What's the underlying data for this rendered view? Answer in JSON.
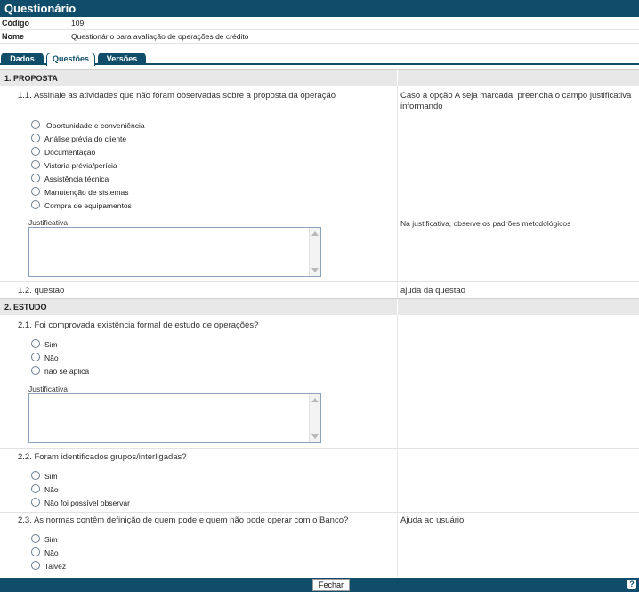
{
  "window": {
    "title": "Questionário"
  },
  "info": {
    "codigo_label": "Código",
    "codigo_value": "109",
    "nome_label": "Nome",
    "nome_value": "Questionário para avaliação de operações de crédito"
  },
  "tabs": [
    {
      "label": "Dados"
    },
    {
      "label": "Questões"
    },
    {
      "label": "Versões"
    }
  ],
  "active_tab": "Questões",
  "sections": [
    {
      "title": "1. PROPOSTA",
      "questions": [
        {
          "text": "1.1. Assinale as atividades que não foram observadas sobre a proposta da operação",
          "help": "Caso a opção A seja marcada, preencha o campo justificativa informando",
          "options": [
            "Oportunidade e conveniência",
            "Análise prévia do cliente",
            "Documentação",
            "Vistoria prévia/perícia",
            "Assistência técnica",
            "Manutenção de sistemas",
            "Compra de equipamentos"
          ],
          "justificativa_label": "Justificativa",
          "justificativa_help": "Na justificativa, observe os padrões metodológicos",
          "justificativa_value": ""
        },
        {
          "text": "1.2. questao",
          "help": "ajuda da questao"
        }
      ]
    },
    {
      "title": "2. ESTUDO",
      "questions": [
        {
          "text": "2.1. Foi comprovada existência formal de estudo de operações?",
          "options": [
            "Sim",
            "Não",
            "não se aplica"
          ],
          "justificativa_label": "Justificativa",
          "justificativa_value": ""
        },
        {
          "text": "2.2. Foram identificados grupos/interligadas?",
          "options": [
            "Sim",
            "Não",
            "Não foi possível observar"
          ]
        },
        {
          "text": "2.3. As normas contêm definição de quem pode e quem não pode operar com o Banco?",
          "help": "Ajuda ao usuário",
          "options": [
            "Sim",
            "Não",
            "Talvez"
          ]
        }
      ]
    }
  ],
  "footer": {
    "close_label": "Fechar",
    "help_label": "?"
  },
  "colors": {
    "brand": "#0f4d6b",
    "section_bg": "#e8e8e8",
    "field_border": "#8aa3ba"
  }
}
